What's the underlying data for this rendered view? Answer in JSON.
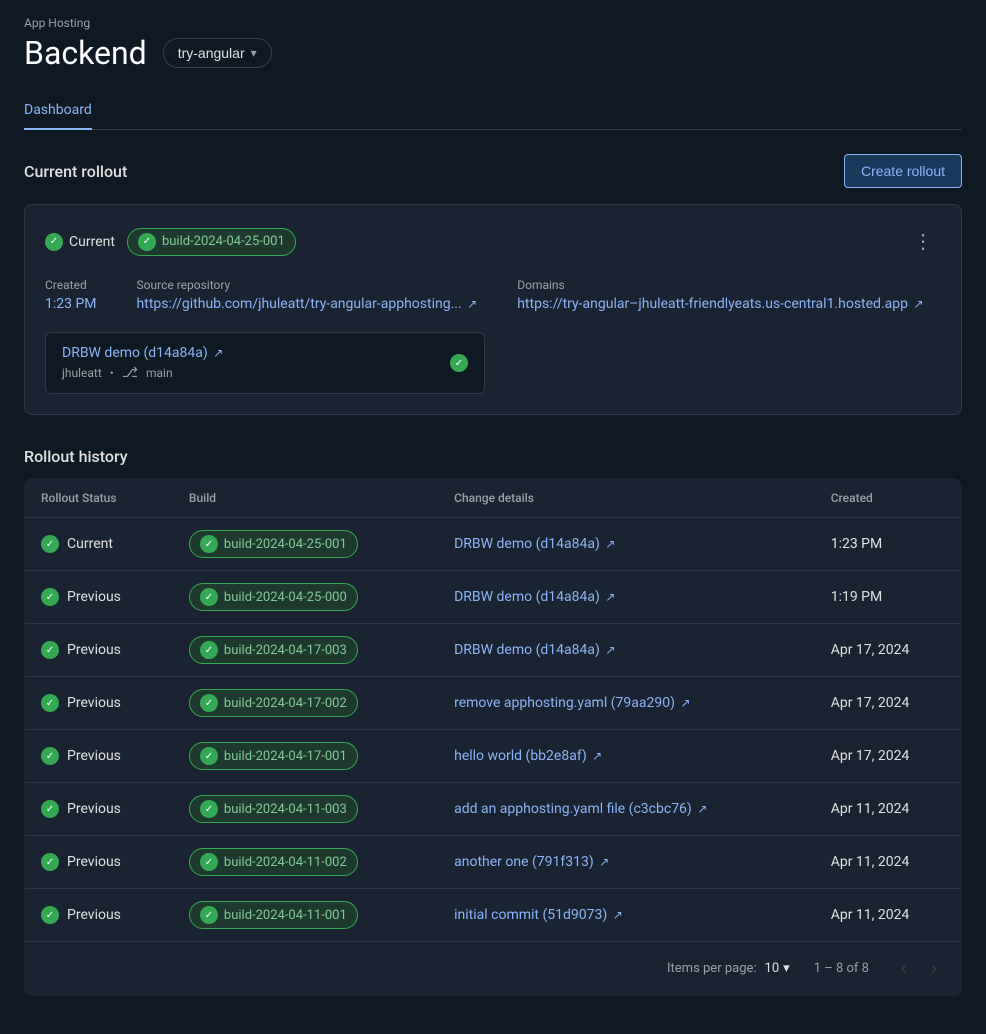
{
  "app": {
    "hosting_label": "App Hosting",
    "backend_title": "Backend",
    "selector_value": "try-angular"
  },
  "tabs": [
    {
      "id": "dashboard",
      "label": "Dashboard",
      "active": true
    }
  ],
  "current_rollout": {
    "section_title": "Current rollout",
    "create_btn_label": "Create rollout",
    "status_label": "Current",
    "build_badge": "build-2024-04-25-001",
    "more_icon": "⋮",
    "created_label": "Created",
    "created_value": "1:23 PM",
    "source_repo_label": "Source repository",
    "source_repo_url": "https://github.com/jhuleatt/try-angular-apphosting...",
    "domains_label": "Domains",
    "domains_url": "https://try-angular–jhuleatt-friendlyeats.us-central1.hosted.app",
    "commit_label": "DRBW demo (d14a84a)",
    "commit_author": "jhuleatt",
    "commit_branch": "main"
  },
  "rollout_history": {
    "title": "Rollout history",
    "columns": {
      "status": "Rollout Status",
      "build": "Build",
      "change_details": "Change details",
      "created": "Created"
    },
    "rows": [
      {
        "status": "Current",
        "build": "build-2024-04-25-001",
        "change": "DRBW demo (d14a84a)",
        "created": "1:23 PM"
      },
      {
        "status": "Previous",
        "build": "build-2024-04-25-000",
        "change": "DRBW demo (d14a84a)",
        "created": "1:19 PM"
      },
      {
        "status": "Previous",
        "build": "build-2024-04-17-003",
        "change": "DRBW demo (d14a84a)",
        "created": "Apr 17, 2024"
      },
      {
        "status": "Previous",
        "build": "build-2024-04-17-002",
        "change": "remove apphosting.yaml (79aa290)",
        "created": "Apr 17, 2024"
      },
      {
        "status": "Previous",
        "build": "build-2024-04-17-001",
        "change": "hello world (bb2e8af)",
        "created": "Apr 17, 2024"
      },
      {
        "status": "Previous",
        "build": "build-2024-04-11-003",
        "change": "add an apphosting.yaml file (c3cbc76)",
        "created": "Apr 11, 2024"
      },
      {
        "status": "Previous",
        "build": "build-2024-04-11-002",
        "change": "another one (791f313)",
        "created": "Apr 11, 2024"
      },
      {
        "status": "Previous",
        "build": "build-2024-04-11-001",
        "change": "initial commit (51d9073)",
        "created": "Apr 11, 2024"
      }
    ],
    "pagination": {
      "items_per_page_label": "Items per page:",
      "items_per_page_value": "10",
      "range_label": "1 – 8 of 8"
    }
  }
}
